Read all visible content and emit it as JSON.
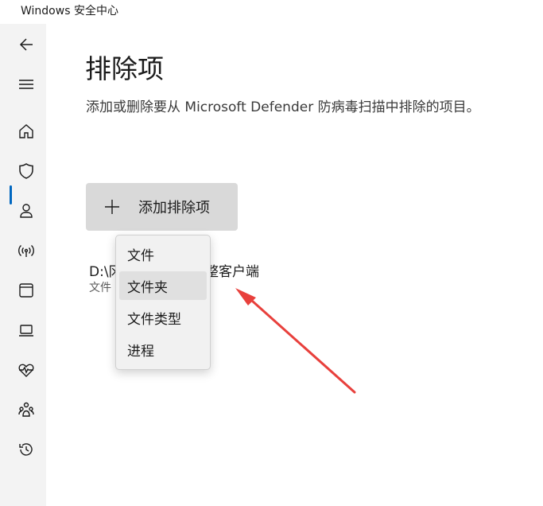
{
  "window": {
    "title": "Windows 安全中心"
  },
  "sidebar": {
    "items": [
      {
        "icon": "back-arrow-icon"
      },
      {
        "icon": "hamburger-menu-icon"
      },
      {
        "icon": "home-icon"
      },
      {
        "icon": "shield-icon",
        "active": true
      },
      {
        "icon": "person-icon"
      },
      {
        "icon": "wireless-icon"
      },
      {
        "icon": "app-browser-icon"
      },
      {
        "icon": "laptop-icon"
      },
      {
        "icon": "heart-pulse-icon"
      },
      {
        "icon": "family-icon"
      },
      {
        "icon": "history-icon"
      }
    ],
    "accent_color": "#0067c0"
  },
  "main": {
    "title": "排除项",
    "description": "添加或删除要从 Microsoft Defender 防病毒扫描中排除的项目。",
    "add_button_label": "添加排除项",
    "exclusion": {
      "path_start": "D:\\冈",
      "path_end": "整客户端",
      "type_label": "文件"
    }
  },
  "dropdown": {
    "items": [
      {
        "label": "文件"
      },
      {
        "label": "文件夹",
        "hovered": true
      },
      {
        "label": "文件类型"
      },
      {
        "label": "进程"
      }
    ]
  },
  "annotation": {
    "arrow_color": "#e8403c"
  }
}
